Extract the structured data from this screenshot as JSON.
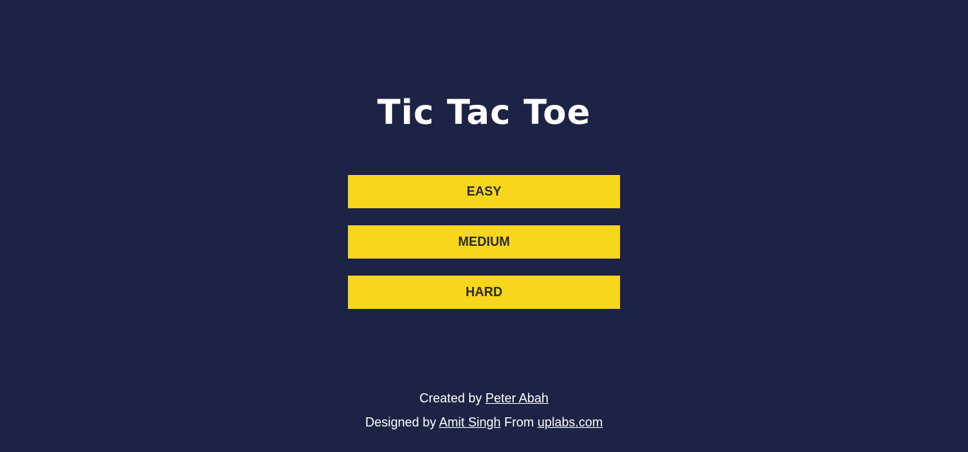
{
  "page": {
    "title": "Tic Tac Toe"
  },
  "menu": {
    "buttons": [
      {
        "label": "EASY"
      },
      {
        "label": "MEDIUM"
      },
      {
        "label": "HARD"
      }
    ]
  },
  "footer": {
    "created_prefix": "Created by",
    "created_name": "Peter Abah",
    "designed_prefix": "Designed by",
    "designed_name": "Amit Singh",
    "from_text": "From",
    "site": "uplabs.com"
  },
  "colors": {
    "background": "#1c2344",
    "button": "#f8d61b",
    "button_text": "#2b2a2a",
    "text": "#ffffff"
  }
}
